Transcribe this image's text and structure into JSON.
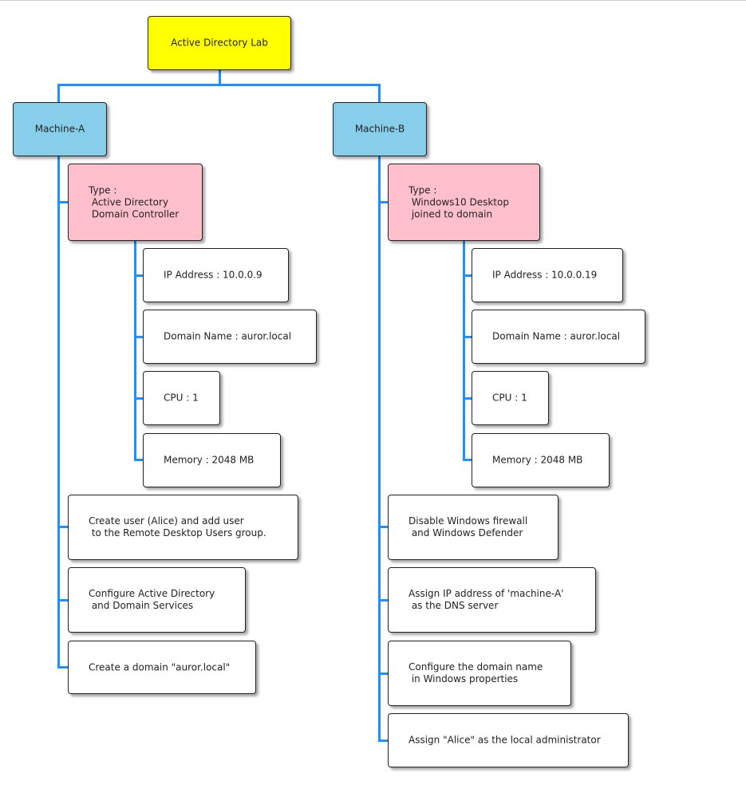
{
  "root": {
    "label": "Active Directory Lab",
    "color": "#ffff00"
  },
  "colors": {
    "machine": "#87ceeb",
    "type": "#ffc0cb",
    "connector": "#1e90ff",
    "leaf": "#ffffff"
  },
  "machines": [
    {
      "label": "Machine-A",
      "type": "Type :\n Active Directory\n Domain Controller",
      "specs": [
        "IP Address : 10.0.0.9",
        "Domain Name : auror.local",
        "CPU : 1",
        "Memory : 2048 MB"
      ],
      "tasks": [
        "Create user (Alice) and add user\n to the Remote Desktop Users group.",
        "Configure Active Directory\n and Domain Services",
        "Create a domain \"auror.local\""
      ]
    },
    {
      "label": "Machine-B",
      "type": "Type :\n Windows10 Desktop\n joined to domain",
      "specs": [
        "IP Address : 10.0.0.19",
        "Domain Name : auror.local",
        "CPU : 1",
        "Memory : 2048 MB"
      ],
      "tasks": [
        "Disable Windows firewall\n and Windows Defender",
        "Assign IP address of 'machine-A'\n as the DNS server",
        "Configure the domain name\n in Windows properties",
        "Assign \"Alice\" as the local administrator"
      ]
    }
  ]
}
